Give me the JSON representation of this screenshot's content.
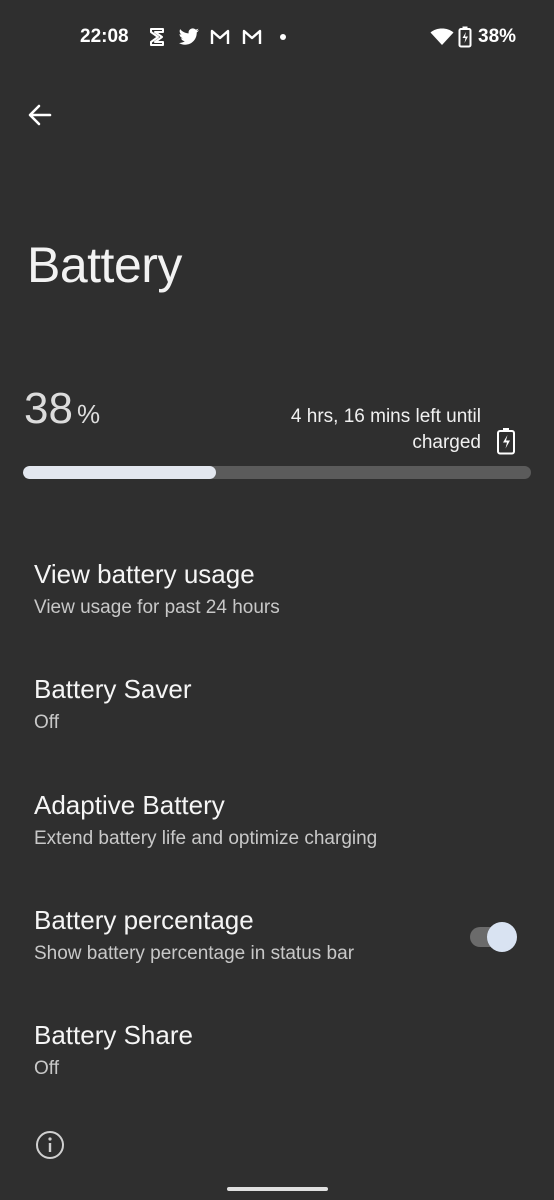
{
  "status_bar": {
    "time": "22:08",
    "notification_icons": [
      "s-icon",
      "twitter-icon",
      "gmail-icon",
      "gmail-icon",
      "dot-icon"
    ],
    "battery_percent": "38%"
  },
  "header": {
    "title": "Battery"
  },
  "summary": {
    "level": "38",
    "unit": "%",
    "level_fraction": 0.38,
    "remaining_line1": "4 hrs, 16 mins left until",
    "remaining_line2": "charged"
  },
  "items": [
    {
      "title": "View battery usage",
      "subtitle": "View usage for past 24 hours"
    },
    {
      "title": "Battery Saver",
      "subtitle": "Off"
    },
    {
      "title": "Adaptive Battery",
      "subtitle": "Extend battery life and optimize charging"
    },
    {
      "title": "Battery percentage",
      "subtitle": "Show battery percentage in status bar",
      "toggle_on": true
    },
    {
      "title": "Battery Share",
      "subtitle": "Off"
    }
  ],
  "colors": {
    "background": "#2f2f2f",
    "bar_fill": "#e3e7ef",
    "bar_track": "#5b5b5b",
    "toggle_thumb": "#d9e3f2"
  }
}
